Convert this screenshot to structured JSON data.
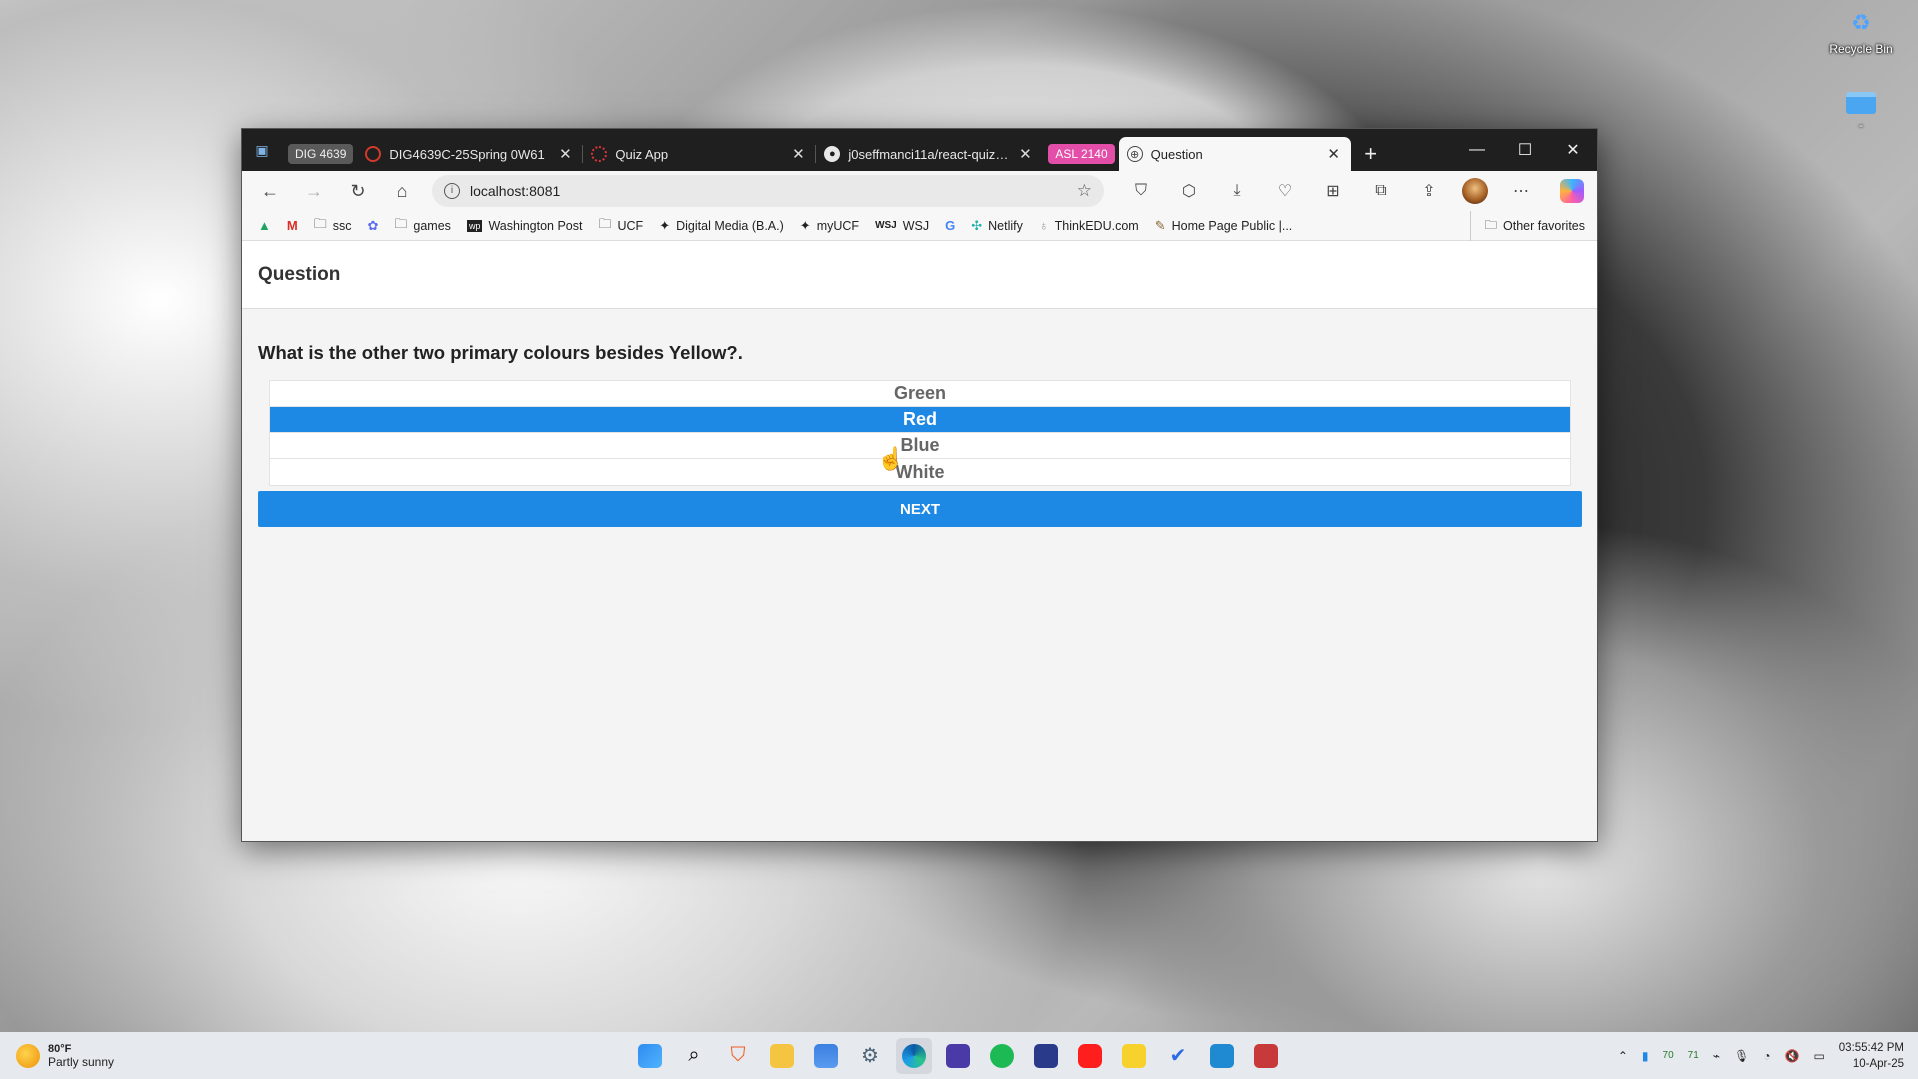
{
  "desktop": {
    "recycle_bin_label": "Recycle Bin",
    "folder_label": "-"
  },
  "browser": {
    "tabs": [
      {
        "group": "DIG 4639",
        "group_color": "#5a5a5a",
        "title": "DIG4639C-25Spring 0W61",
        "favicon_color": "#d33a2c"
      },
      {
        "title": "Quiz App",
        "favicon_color": "#e0343a"
      },
      {
        "title": "j0seffmanci11a/react-quiz-app",
        "favicon_color": "#e8e8e8"
      },
      {
        "group": "ASL 2140",
        "group_color": "#e34ea8",
        "title": "Question",
        "active": true
      }
    ],
    "new_tab_label": "+",
    "address": {
      "url": "localhost:8081"
    },
    "bookmarks": [
      {
        "label": "",
        "icon": "google-drive-icon"
      },
      {
        "label": "",
        "icon": "gmail-icon"
      },
      {
        "label": "ssc",
        "icon": "folder-icon"
      },
      {
        "label": "",
        "icon": "app-icon"
      },
      {
        "label": "games",
        "icon": "folder-icon"
      },
      {
        "label": "Washington Post",
        "icon": "wp-icon"
      },
      {
        "label": "UCF",
        "icon": "folder-icon"
      },
      {
        "label": "Digital Media (B.A.)",
        "icon": "ucf-icon"
      },
      {
        "label": "myUCF",
        "icon": "ucf-icon"
      },
      {
        "label": "WSJ",
        "icon": "wsj-icon"
      },
      {
        "label": "",
        "icon": "google-icon"
      },
      {
        "label": "Netlify",
        "icon": "netlify-icon"
      },
      {
        "label": "ThinkEDU.com",
        "icon": "bulb-icon"
      },
      {
        "label": "Home Page Public |...",
        "icon": "page-icon"
      }
    ],
    "other_favorites": "Other favorites"
  },
  "app": {
    "header_title": "Question",
    "question": "What is the other two primary colours besides Yellow?.",
    "options": [
      {
        "label": "Green",
        "selected": false
      },
      {
        "label": "Red",
        "selected": true
      },
      {
        "label": "Blue",
        "selected": false
      },
      {
        "label": "White",
        "selected": false
      }
    ],
    "next_label": "NEXT",
    "accent_color": "#1e88e5"
  },
  "taskbar": {
    "weather_temp": "80°F",
    "weather_condition": "Partly sunny",
    "tray_numbers": [
      "70",
      "71"
    ],
    "time": "03:55:42 PM",
    "date": "10-Apr-25"
  }
}
